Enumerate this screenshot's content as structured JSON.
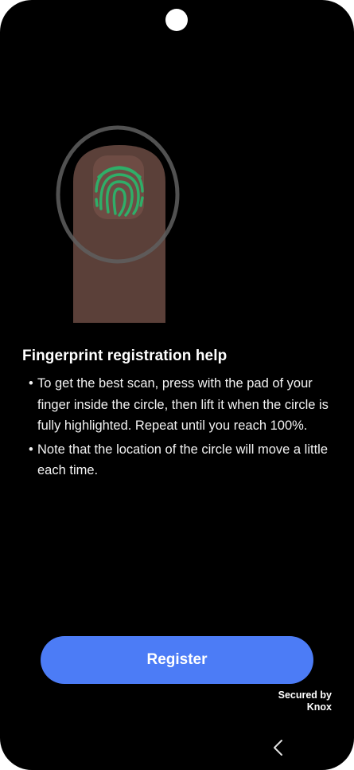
{
  "help": {
    "title": "Fingerprint registration help",
    "bullets": [
      "To get the best scan, press with the pad of your finger inside the circle, then lift it when the circle is fully highlighted. Repeat until you reach 100%.",
      "Note that the location of the circle will move a little each time."
    ]
  },
  "register_label": "Register",
  "secured": {
    "line1": "Secured by",
    "line2": "Knox"
  },
  "colors": {
    "background": "#000000",
    "button": "#4c7cf6",
    "finger": "#5b4039",
    "fingerprint": "#2fae68",
    "ring": "#5f5f5f"
  },
  "icons": {
    "illustration": "finger-on-sensor-illustration",
    "back": "chevron-left-icon",
    "camera": "front-camera-cutout"
  }
}
